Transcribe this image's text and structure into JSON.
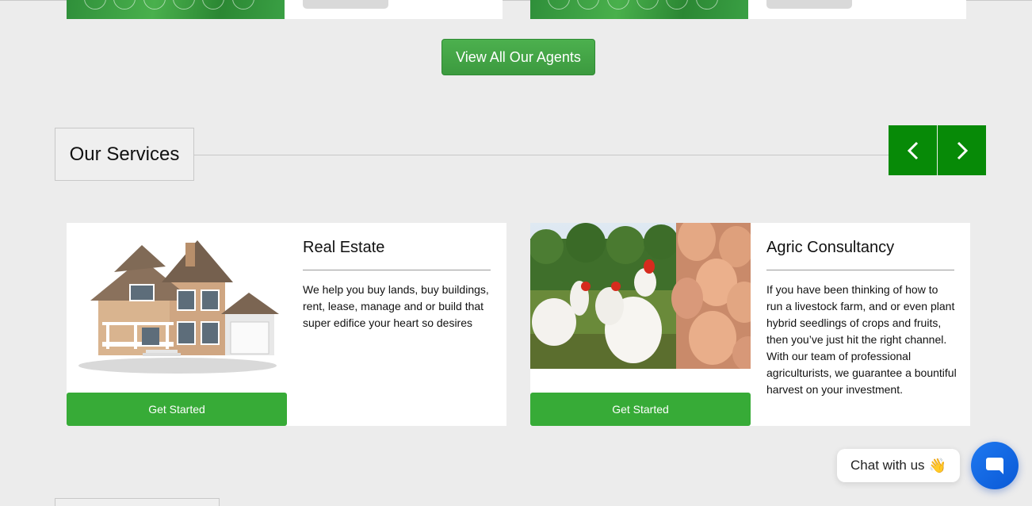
{
  "agents_section": {
    "view_all_label": "View All Our Agents"
  },
  "services_section": {
    "heading": "Our Services",
    "services": [
      {
        "title": "Real Estate",
        "description": "We help you buy lands, buy buildings, rent, lease, manage and or build that super edifice your heart so desires",
        "button_label": "Get Started",
        "image": "house-illustration"
      },
      {
        "title": "Agric Consultancy",
        "description": "If you have been thinking of how to run a livestock farm, and or even plant hybrid seedlings of crops and fruits, then you’ve just hit the right channel. With our team of professional agriculturists, we guarantee a bountiful harvest on your investment.",
        "button_label": "Get Started",
        "image": "chickens-and-eggs-photo"
      }
    ]
  },
  "chat_widget": {
    "label": "Chat with us",
    "emoji": "👋",
    "launcher_icon": "chat-bubble-icon"
  },
  "colors": {
    "brand_green": "#37ab37",
    "dark_green": "#078a07",
    "chat_blue": "#1e78f0",
    "page_bg": "#ececec"
  }
}
